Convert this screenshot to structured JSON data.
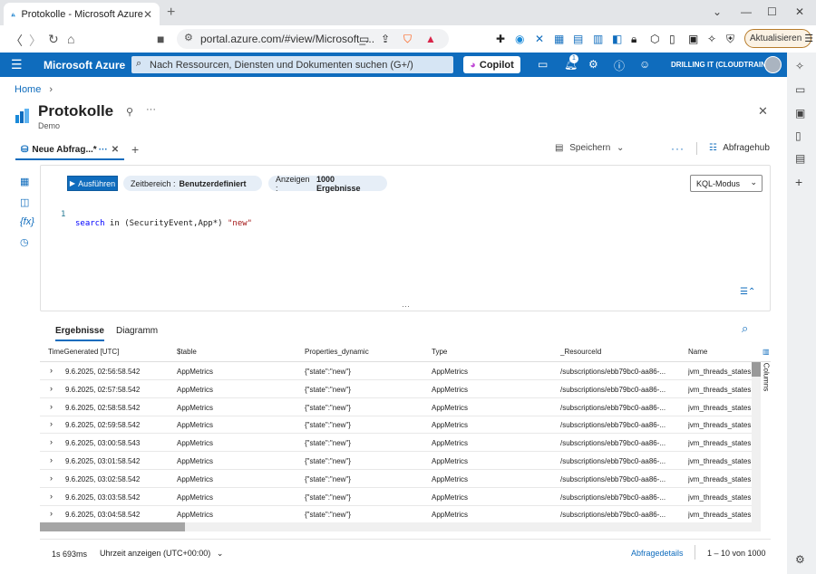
{
  "browser": {
    "tab_title": "Protokolle - Microsoft Azure",
    "url": "portal.azure.com/#view/Microsoft_...",
    "update_button": "Aktualisieren"
  },
  "azure_header": {
    "brand": "Microsoft Azure",
    "search_placeholder": "Nach Ressourcen, Diensten und Dokumenten suchen (G+/)",
    "copilot": "Copilot",
    "notification_count": "1",
    "tenant": "DRILLING IT (CLOUDTRAIN.DE)"
  },
  "page": {
    "breadcrumb": "Home",
    "title": "Protokolle",
    "subtitle": "Demo"
  },
  "query_tab": {
    "label": "Neue Abfrag...*",
    "save": "Speichern",
    "hub": "Abfragehub"
  },
  "editor": {
    "run": "Ausführen",
    "timerange_label": "Zeitbereich :",
    "timerange_value": "Benutzerdefiniert",
    "show_label": "Anzeigen :",
    "show_value": "1000 Ergebnisse",
    "mode": "KQL-Modus",
    "line_number": "1",
    "code_keyword": "search",
    "code_rest": " in (SecurityEvent,App*) ",
    "code_string": "\"new\""
  },
  "results": {
    "tabs": [
      "Ergebnisse",
      "Diagramm"
    ],
    "columns_label": "Columns",
    "headers": [
      "TimeGenerated [UTC]",
      "$table",
      "Properties_dynamic",
      "Type",
      "_ResourceId",
      "Name"
    ],
    "rows": [
      [
        "9.6.2025, 02:56:58.542",
        "AppMetrics",
        "{\"state\":\"new\"}",
        "AppMetrics",
        "/subscriptions/ebb79bc0-aa86-...",
        "jvm_threads_states"
      ],
      [
        "9.6.2025, 02:57:58.542",
        "AppMetrics",
        "{\"state\":\"new\"}",
        "AppMetrics",
        "/subscriptions/ebb79bc0-aa86-...",
        "jvm_threads_states"
      ],
      [
        "9.6.2025, 02:58:58.542",
        "AppMetrics",
        "{\"state\":\"new\"}",
        "AppMetrics",
        "/subscriptions/ebb79bc0-aa86-...",
        "jvm_threads_states"
      ],
      [
        "9.6.2025, 02:59:58.542",
        "AppMetrics",
        "{\"state\":\"new\"}",
        "AppMetrics",
        "/subscriptions/ebb79bc0-aa86-...",
        "jvm_threads_states"
      ],
      [
        "9.6.2025, 03:00:58.543",
        "AppMetrics",
        "{\"state\":\"new\"}",
        "AppMetrics",
        "/subscriptions/ebb79bc0-aa86-...",
        "jvm_threads_states"
      ],
      [
        "9.6.2025, 03:01:58.542",
        "AppMetrics",
        "{\"state\":\"new\"}",
        "AppMetrics",
        "/subscriptions/ebb79bc0-aa86-...",
        "jvm_threads_states"
      ],
      [
        "9.6.2025, 03:02:58.542",
        "AppMetrics",
        "{\"state\":\"new\"}",
        "AppMetrics",
        "/subscriptions/ebb79bc0-aa86-...",
        "jvm_threads_states"
      ],
      [
        "9.6.2025, 03:03:58.542",
        "AppMetrics",
        "{\"state\":\"new\"}",
        "AppMetrics",
        "/subscriptions/ebb79bc0-aa86-...",
        "jvm_threads_states"
      ],
      [
        "9.6.2025, 03:04:58.542",
        "AppMetrics",
        "{\"state\":\"new\"}",
        "AppMetrics",
        "/subscriptions/ebb79bc0-aa86-...",
        "jvm_threads_states"
      ]
    ]
  },
  "footer": {
    "duration": "1s 693ms",
    "time_display": "Uhrzeit anzeigen (UTC+00:00)",
    "details": "Abfragedetails",
    "paging": "1 – 10 von 1000"
  },
  "colors": {
    "azure_blue": "#0f6cbd",
    "code_keyword": "#0000ff",
    "code_string": "#a31515"
  }
}
